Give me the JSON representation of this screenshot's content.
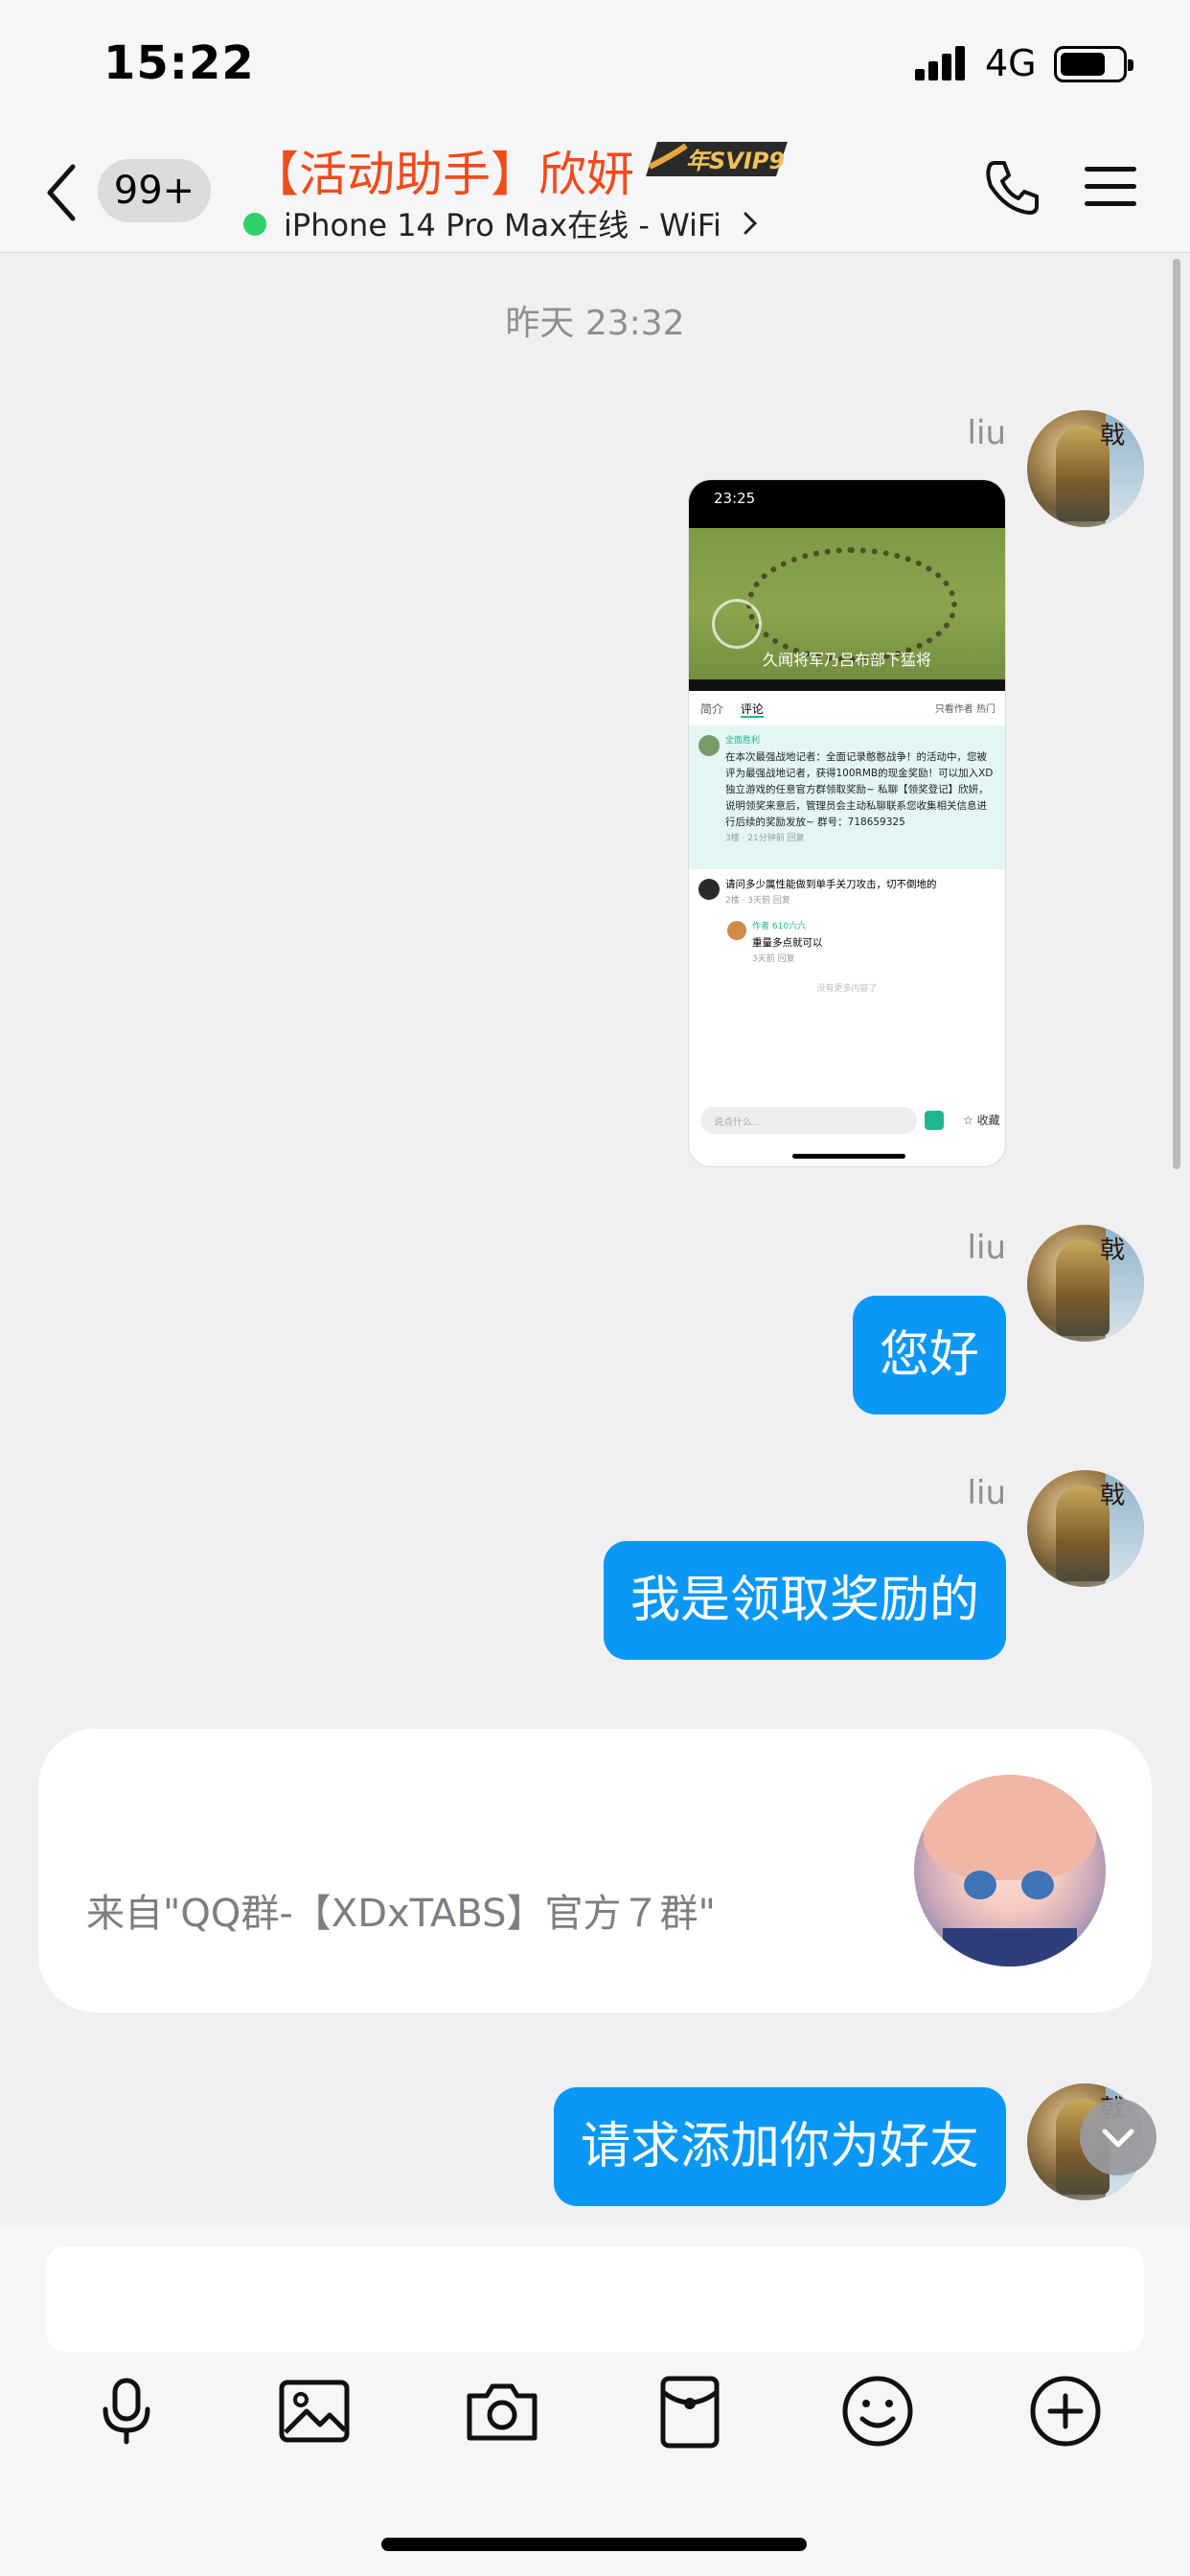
{
  "status_bar": {
    "time": "15:22",
    "network": "4G"
  },
  "header": {
    "unread_badge": "99+",
    "title": "【活动助手】欣妍",
    "vip_badge": "年SVIP9",
    "subtitle": "iPhone 14 Pro Max在线 - WiFi"
  },
  "chat": {
    "timestamp": "昨天 23:32",
    "sender_name": "liu",
    "messages": [
      "您好",
      "我是领取奖励的",
      "请求添加你为好友"
    ],
    "shared_card_source": "来自\"QQ群-【XDxTABS】官方７群\""
  },
  "screenshot": {
    "time": "23:25",
    "video_caption": "久闻将军乃吕布部下猛将",
    "tab_intro": "简介",
    "tab_comments": "评论",
    "tab_right": "只看作者  热门",
    "pinned_author": "全面胜利",
    "pinned_text": "在本次最强战地记者：全面记录憨憨战争！的活动中，您被评为最强战地记者，获得100RMB的现金奖励！可以加入XD独立游戏的任意官方群领取奖励~ 私聊【领奖登记】欣妍，说明领奖来意后，管理员会主动私聊联系您收集相关信息进行后续的奖励发放~ 群号：718659325",
    "pinned_meta": "3楼 · 21分钟前  回复",
    "comment_text": "请问多少属性能做到单手关刀攻击，切不倒地的",
    "comment_meta": "2楼 · 3天前  回复",
    "reply_author": "作者 610六六",
    "reply_text": "重量多点就可以",
    "reply_meta": "3天前  回复",
    "no_more": "没有更多内容了",
    "input_placeholder": "说点什么...",
    "fav_label": "收藏"
  }
}
